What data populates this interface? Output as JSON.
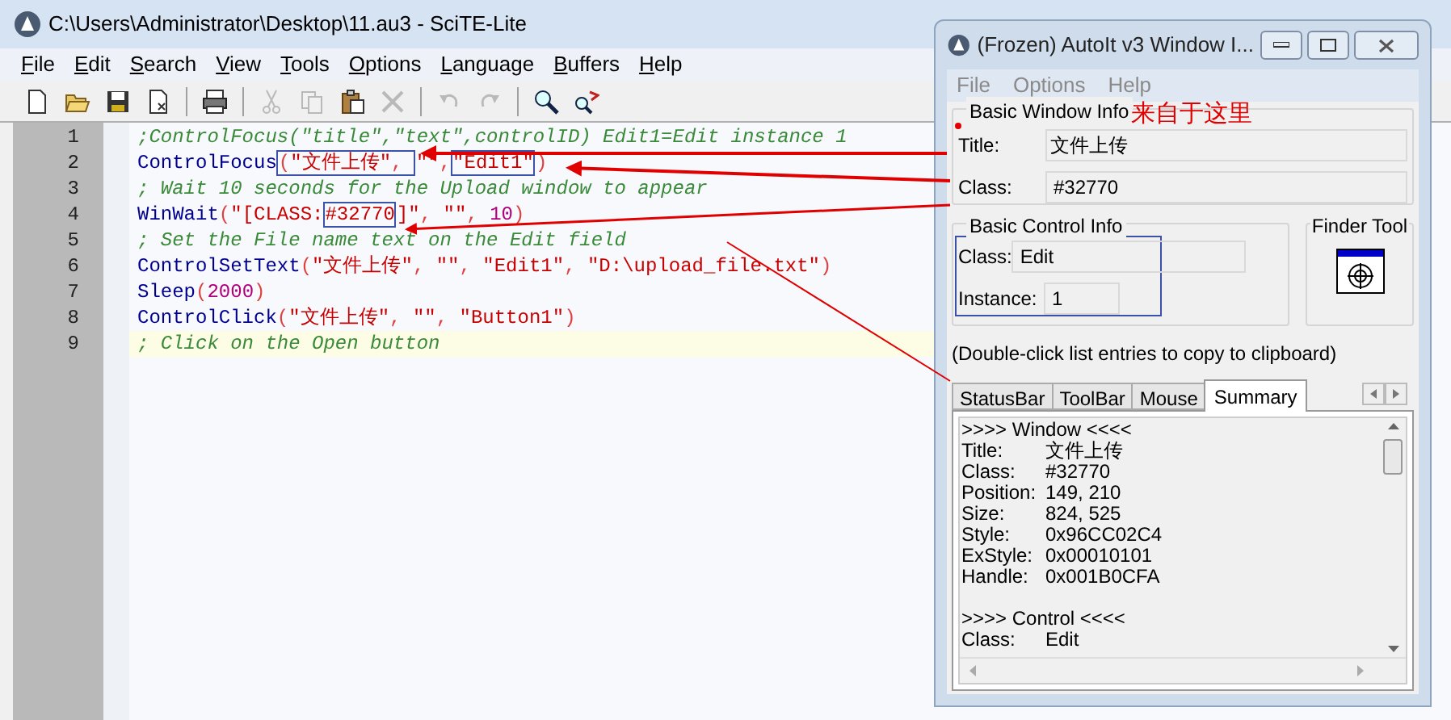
{
  "editor_window": {
    "title": "C:\\Users\\Administrator\\Desktop\\11.au3 - SciTE-Lite",
    "menu": [
      "File",
      "Edit",
      "Search",
      "View",
      "Tools",
      "Options",
      "Language",
      "Buffers",
      "Help"
    ],
    "toolbar": [
      {
        "buttons": [
          {
            "kind": "new",
            "disabled": false
          },
          {
            "kind": "open",
            "disabled": false
          },
          {
            "kind": "save",
            "disabled": false
          },
          {
            "kind": "close",
            "disabled": false
          }
        ]
      },
      {
        "buttons": [
          {
            "kind": "print",
            "disabled": false
          }
        ]
      },
      {
        "buttons": [
          {
            "kind": "cut",
            "disabled": true
          },
          {
            "kind": "copy",
            "disabled": true
          },
          {
            "kind": "paste",
            "disabled": false
          },
          {
            "kind": "delete",
            "disabled": true
          }
        ]
      },
      {
        "buttons": [
          {
            "kind": "undo",
            "disabled": true
          },
          {
            "kind": "redo",
            "disabled": true
          }
        ]
      },
      {
        "buttons": [
          {
            "kind": "find",
            "disabled": false
          },
          {
            "kind": "replace",
            "disabled": false
          }
        ]
      }
    ],
    "lines": [
      {
        "number": "1",
        "current": false,
        "tokens": [
          {
            "kind": "comment",
            "text": ";ControlFocus(\"title\",\"text\",controlID) Edit1=Edit instance 1",
            "boxed": false
          }
        ]
      },
      {
        "number": "2",
        "current": false,
        "tokens": [
          {
            "kind": "func",
            "text": "ControlFocus",
            "boxed": false
          },
          {
            "kind": "op",
            "text": "(",
            "boxed": true
          },
          {
            "kind": "string",
            "text": "\"文件上传\"",
            "boxed": true
          },
          {
            "kind": "op",
            "text": ", ",
            "boxed": true
          },
          {
            "kind": "string",
            "text": "\"\"",
            "boxed": false
          },
          {
            "kind": "op",
            "text": ",",
            "boxed": false
          },
          {
            "kind": "string",
            "text": "\"Edit1\"",
            "boxed": true
          },
          {
            "kind": "op",
            "text": ")",
            "boxed": false
          }
        ]
      },
      {
        "number": "3",
        "current": false,
        "tokens": [
          {
            "kind": "comment",
            "text": "; Wait 10 seconds for the Upload window to appear",
            "boxed": false
          }
        ]
      },
      {
        "number": "4",
        "current": false,
        "tokens": [
          {
            "kind": "func",
            "text": "WinWait",
            "boxed": false
          },
          {
            "kind": "op",
            "text": "(",
            "boxed": false
          },
          {
            "kind": "string",
            "text": "\"[CLASS:",
            "boxed": false
          },
          {
            "kind": "string",
            "text": "#32770",
            "boxed": true
          },
          {
            "kind": "string",
            "text": "]\"",
            "boxed": false
          },
          {
            "kind": "op",
            "text": ", ",
            "boxed": false
          },
          {
            "kind": "string",
            "text": "\"\"",
            "boxed": false
          },
          {
            "kind": "op",
            "text": ", ",
            "boxed": false
          },
          {
            "kind": "number",
            "text": "10",
            "boxed": false
          },
          {
            "kind": "op",
            "text": ")",
            "boxed": false
          }
        ]
      },
      {
        "number": "5",
        "current": false,
        "tokens": [
          {
            "kind": "comment",
            "text": "; Set the File name text on the Edit field",
            "boxed": false
          }
        ]
      },
      {
        "number": "6",
        "current": false,
        "tokens": [
          {
            "kind": "func",
            "text": "ControlSetText",
            "boxed": false
          },
          {
            "kind": "op",
            "text": "(",
            "boxed": false
          },
          {
            "kind": "string",
            "text": "\"文件上传\"",
            "boxed": false
          },
          {
            "kind": "op",
            "text": ", ",
            "boxed": false
          },
          {
            "kind": "string",
            "text": "\"\"",
            "boxed": false
          },
          {
            "kind": "op",
            "text": ", ",
            "boxed": false
          },
          {
            "kind": "string",
            "text": "\"Edit1\"",
            "boxed": false
          },
          {
            "kind": "op",
            "text": ", ",
            "boxed": false
          },
          {
            "kind": "string",
            "text": "\"D:\\upload_file.txt\"",
            "boxed": false
          },
          {
            "kind": "op",
            "text": ")",
            "boxed": false
          }
        ]
      },
      {
        "number": "7",
        "current": false,
        "tokens": [
          {
            "kind": "func",
            "text": "Sleep",
            "boxed": false
          },
          {
            "kind": "op",
            "text": "(",
            "boxed": false
          },
          {
            "kind": "number",
            "text": "2000",
            "boxed": false
          },
          {
            "kind": "op",
            "text": ")",
            "boxed": false
          }
        ]
      },
      {
        "number": "8",
        "current": false,
        "tokens": [
          {
            "kind": "func",
            "text": "ControlClick",
            "boxed": false
          },
          {
            "kind": "op",
            "text": "(",
            "boxed": false
          },
          {
            "kind": "string",
            "text": "\"文件上传\"",
            "boxed": false
          },
          {
            "kind": "op",
            "text": ", ",
            "boxed": false
          },
          {
            "kind": "string",
            "text": "\"\"",
            "boxed": false
          },
          {
            "kind": "op",
            "text": ", ",
            "boxed": false
          },
          {
            "kind": "string",
            "text": "\"Button1\"",
            "boxed": false
          },
          {
            "kind": "op",
            "text": ")",
            "boxed": false
          }
        ]
      },
      {
        "number": "9",
        "current": true,
        "tokens": [
          {
            "kind": "comment",
            "text": "; Click on the Open button",
            "boxed": false
          }
        ]
      }
    ]
  },
  "info_window": {
    "title": "(Frozen) AutoIt v3 Window I...",
    "menu": [
      {
        "label": "File",
        "disabled": true
      },
      {
        "label": "Options",
        "disabled": true
      },
      {
        "label": "Help",
        "disabled": true
      }
    ],
    "basic_window_info": {
      "heading": "Basic Window Info",
      "title_label": "Title:",
      "title_value": "文件上传",
      "class_label": "Class:",
      "class_value": "#32770"
    },
    "basic_control_info": {
      "heading": "Basic Control Info",
      "class_label": "Class:",
      "class_value": "Edit",
      "instance_label": "Instance:",
      "instance_value": "1"
    },
    "finder_tool": {
      "heading": "Finder Tool"
    },
    "hint": "(Double-click list entries to copy to clipboard)",
    "tabs": [
      {
        "label": "StatusBar",
        "selected": false
      },
      {
        "label": "ToolBar",
        "selected": false
      },
      {
        "label": "Mouse",
        "selected": false
      },
      {
        "label": "Summary",
        "selected": true
      }
    ],
    "summary": [
      {
        "kind": "header",
        "text": ">>>> Window <<<<"
      },
      {
        "kind": "field",
        "label": "Title:",
        "value": "文件上传"
      },
      {
        "kind": "field",
        "label": "Class:",
        "value": "#32770"
      },
      {
        "kind": "field",
        "label": "Position:",
        "value": "149, 210"
      },
      {
        "kind": "field",
        "label": "Size:",
        "value": "824, 525"
      },
      {
        "kind": "field",
        "label": "Style:",
        "value": "0x96CC02C4"
      },
      {
        "kind": "field",
        "label": "ExStyle:",
        "value": "0x00010101"
      },
      {
        "kind": "field",
        "label": "Handle:",
        "value": "0x001B0CFA"
      },
      {
        "kind": "blank"
      },
      {
        "kind": "header",
        "text": ">>>> Control <<<<"
      },
      {
        "kind": "field",
        "label": "Class:",
        "value": "Edit"
      }
    ]
  },
  "annotation": {
    "note": "来自于这里"
  }
}
